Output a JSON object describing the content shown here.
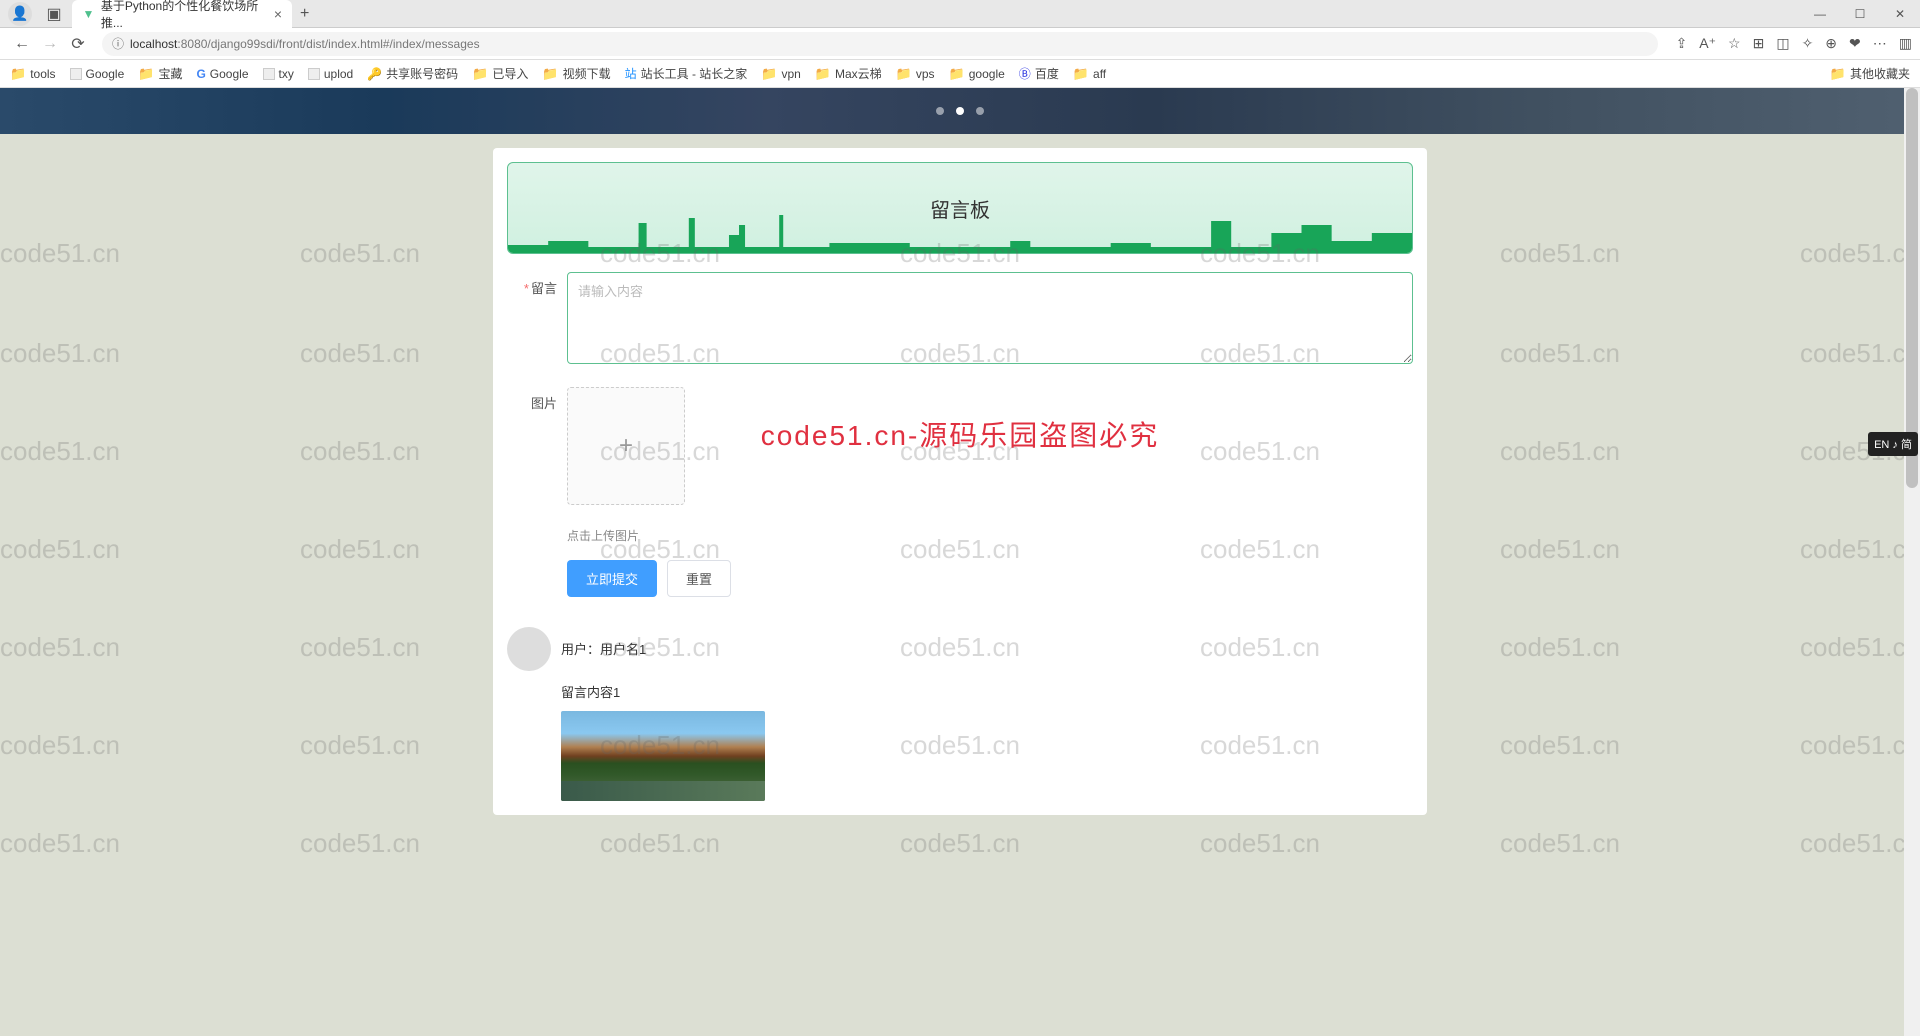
{
  "browser": {
    "tab_title": "基于Python的个性化餐饮场所推...",
    "url_host": "localhost",
    "url_port_path": ":8080/django99sdi/front/dist/index.html#/index/messages",
    "window_controls": {
      "min": "—",
      "max": "☐",
      "close": "✕"
    }
  },
  "bookmarks": [
    {
      "icon": "folder",
      "label": "tools"
    },
    {
      "icon": "page",
      "label": "Google"
    },
    {
      "icon": "folder",
      "label": "宝藏"
    },
    {
      "icon": "g",
      "label": "Google"
    },
    {
      "icon": "txy",
      "label": "txy"
    },
    {
      "icon": "uplod",
      "label": "uplod"
    },
    {
      "icon": "pass",
      "label": "共享账号密码"
    },
    {
      "icon": "folder",
      "label": "已导入"
    },
    {
      "icon": "folder",
      "label": "视频下载"
    },
    {
      "icon": "zz",
      "label": "站长工具 - 站长之家"
    },
    {
      "icon": "folder",
      "label": "vpn"
    },
    {
      "icon": "folder",
      "label": "Max云梯"
    },
    {
      "icon": "folder",
      "label": "vps"
    },
    {
      "icon": "folder",
      "label": "google"
    },
    {
      "icon": "baidu",
      "label": "百度"
    },
    {
      "icon": "folder",
      "label": "aff"
    }
  ],
  "bookmarks_right": {
    "label": "其他收藏夹"
  },
  "watermark_text": "code51.cn",
  "center_watermark": "code51.cn-源码乐园盗图必究",
  "page": {
    "header_title": "留言板",
    "form": {
      "message_label": "留言",
      "message_placeholder": "请输入内容",
      "image_label": "图片",
      "upload_hint": "点击上传图片",
      "submit_button": "立即提交",
      "reset_button": "重置"
    },
    "messages": [
      {
        "user_prefix": "用户：",
        "username": "用户名1",
        "content": "留言内容1"
      }
    ]
  },
  "ime_badge": "EN ♪ 简"
}
